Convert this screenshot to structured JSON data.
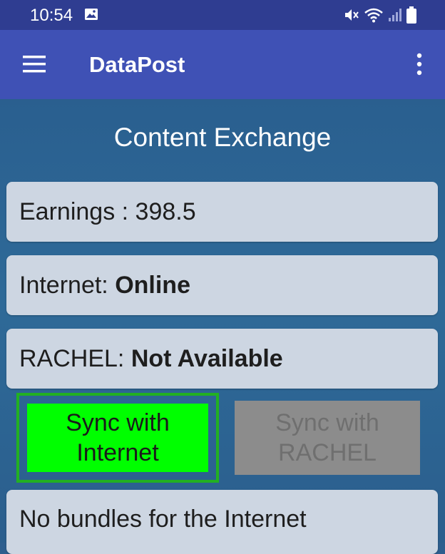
{
  "status_bar": {
    "time": "10:54",
    "icons": [
      "gallery-icon",
      "mute-icon",
      "wifi-icon",
      "signal-icon",
      "battery-icon"
    ]
  },
  "app_bar": {
    "title": "DataPost",
    "background": "#3F51B5"
  },
  "main": {
    "heading": "Content Exchange",
    "earnings": {
      "text": "Earnings : 398.5"
    },
    "internet": {
      "label": "Internet: ",
      "value": "Online"
    },
    "rachel": {
      "label": "RACHEL: ",
      "value": "Not Available"
    },
    "buttons": {
      "sync_internet_line1": "Sync with",
      "sync_internet_line2": "Internet",
      "sync_rachel_line1": "Sync with",
      "sync_rachel_line2": "RACHEL"
    },
    "bundles": {
      "text": "No bundles for the Internet"
    }
  },
  "colors": {
    "status_bar": "#2F3D91",
    "sync_internet_button": "#00FF00",
    "sync_internet_border": "#22B022",
    "sync_rachel_button_disabled": "#8C8C8C",
    "card": "#CDD6E2"
  }
}
